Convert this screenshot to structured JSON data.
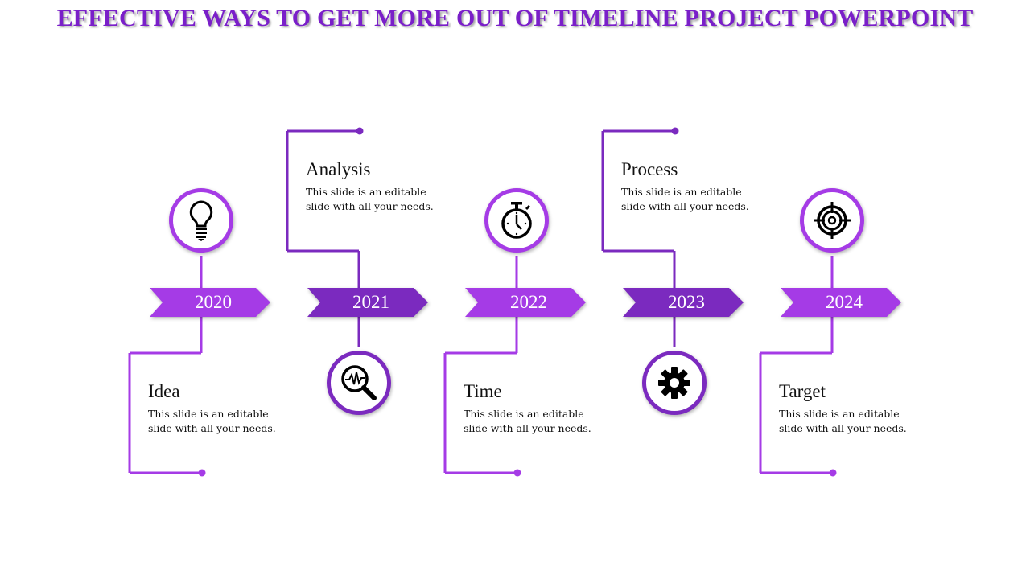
{
  "title": "EFFECTIVE WAYS TO GET MORE OUT OF TIMELINE PROJECT POWERPOINT",
  "colors": {
    "title": "#7a1fc9",
    "light_purple": "#a53be6",
    "dark_purple": "#7b2abf",
    "text": "#111111"
  },
  "milestones": [
    {
      "year": "2020",
      "heading": "Idea",
      "description": "This slide is an editable slide with all your needs.",
      "icon": "lightbulb-icon",
      "icon_position": "top",
      "text_position": "bottom",
      "color": "light"
    },
    {
      "year": "2021",
      "heading": "Analysis",
      "description": "This slide is an editable slide with all your needs.",
      "icon": "magnifier-pulse-icon",
      "icon_position": "bottom",
      "text_position": "top",
      "color": "dark"
    },
    {
      "year": "2022",
      "heading": "Time",
      "description": "This slide is an editable slide with all your needs.",
      "icon": "stopwatch-icon",
      "icon_position": "top",
      "text_position": "bottom",
      "color": "light"
    },
    {
      "year": "2023",
      "heading": "Process",
      "description": "This slide is an editable slide with all your needs.",
      "icon": "gear-icon",
      "icon_position": "bottom",
      "text_position": "top",
      "color": "dark"
    },
    {
      "year": "2024",
      "heading": "Target",
      "description": "This slide is an editable slide with all your needs.",
      "icon": "target-icon",
      "icon_position": "top",
      "text_position": "bottom",
      "color": "light"
    }
  ]
}
